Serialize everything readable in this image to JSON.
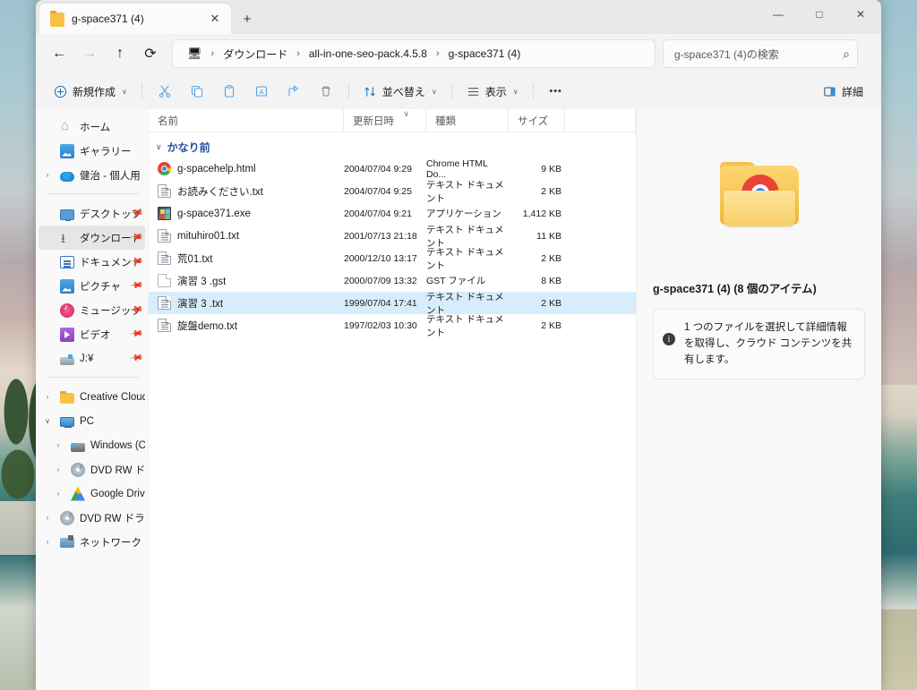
{
  "window": {
    "tab_title": "g-space371 (4)",
    "tab_close": "✕",
    "new_tab": "+",
    "minimize": "—",
    "maximize": "□",
    "close": "✕"
  },
  "nav": {
    "back": "←",
    "forward": "→",
    "up": "↑",
    "refresh": "⟳",
    "breadcrumb": [
      {
        "label": "🖥",
        "name": "this-pc"
      },
      {
        "label": "ダウンロード",
        "name": "downloads"
      },
      {
        "label": "all-in-one-seo-pack.4.5.8",
        "name": "all-in-one-seo-pack"
      },
      {
        "label": "g-space371 (4)",
        "name": "g-space371-4"
      }
    ],
    "separator": "›",
    "search_placeholder": "g-space371 (4)の検索",
    "search_icon": "⌕"
  },
  "toolbar": {
    "new_label": "新規作成",
    "cut_label": "切り取り",
    "copy_label": "コピー",
    "paste_label": "貼り付け",
    "rename_label": "名前の変更",
    "share_label": "共有",
    "delete_label": "削除",
    "sort_label": "並べ替え",
    "view_label": "表示",
    "more_label": "•••",
    "details_label": "詳細",
    "chevron": "∨"
  },
  "sidebar": {
    "items": [
      {
        "label": "ホーム",
        "icon": "home-icon",
        "chevron": "",
        "pinned": false,
        "selected": false,
        "indent": 0
      },
      {
        "label": "ギャラリー",
        "icon": "gallery-icon",
        "chevron": "",
        "pinned": false,
        "selected": false,
        "indent": 0
      },
      {
        "label": "健治 - 個人用",
        "icon": "onedrive-cloud-icon",
        "chevron": "›",
        "pinned": false,
        "selected": false,
        "indent": 0
      },
      {
        "separator": true
      },
      {
        "label": "デスクトップ",
        "icon": "desktop-icon",
        "chevron": "",
        "pinned": true,
        "selected": false,
        "indent": 0
      },
      {
        "label": "ダウンロード",
        "icon": "downloads-icon",
        "chevron": "",
        "pinned": true,
        "selected": true,
        "indent": 0
      },
      {
        "label": "ドキュメント",
        "icon": "documents-icon",
        "chevron": "",
        "pinned": true,
        "selected": false,
        "indent": 0
      },
      {
        "label": "ピクチャ",
        "icon": "pictures-icon",
        "chevron": "",
        "pinned": true,
        "selected": false,
        "indent": 0
      },
      {
        "label": "ミュージック",
        "icon": "music-icon",
        "chevron": "",
        "pinned": true,
        "selected": false,
        "indent": 0
      },
      {
        "label": "ビデオ",
        "icon": "video-icon",
        "chevron": "",
        "pinned": true,
        "selected": false,
        "indent": 0
      },
      {
        "label": "J:¥",
        "icon": "drive-icon",
        "chevron": "",
        "pinned": true,
        "selected": false,
        "indent": 0
      },
      {
        "separator": true
      },
      {
        "label": "Creative Cloud Files",
        "icon": "folder-icon",
        "chevron": "›",
        "pinned": false,
        "selected": false,
        "indent": 0
      },
      {
        "label": "PC",
        "icon": "pc-icon",
        "chevron": "∨",
        "pinned": false,
        "selected": false,
        "indent": 0
      },
      {
        "label": "Windows (C:)",
        "icon": "windows-disk-icon",
        "chevron": "›",
        "pinned": false,
        "selected": false,
        "indent": 1
      },
      {
        "label": "DVD RW ドライブ (C",
        "icon": "dvd-icon",
        "chevron": "›",
        "pinned": false,
        "selected": false,
        "indent": 1
      },
      {
        "label": "Google Drive (I:)",
        "icon": "google-drive-icon",
        "chevron": "›",
        "pinned": false,
        "selected": false,
        "indent": 1
      },
      {
        "label": "DVD RW ドライブ (G:",
        "icon": "dvd-icon",
        "chevron": "›",
        "pinned": false,
        "selected": false,
        "indent": 0
      },
      {
        "label": "ネットワーク",
        "icon": "network-icon",
        "chevron": "›",
        "pinned": false,
        "selected": false,
        "indent": 0
      }
    ]
  },
  "filelist": {
    "columns": {
      "name": "名前",
      "date": "更新日時",
      "type": "種類",
      "size": "サイズ"
    },
    "sort_indicator": "∨",
    "group": {
      "chevron": "∨",
      "label": "かなり前"
    },
    "rows": [
      {
        "name": "g-spacehelp.html",
        "date": "2004/07/04 9:29",
        "type": "Chrome HTML Do...",
        "size": "9 KB",
        "icon": "chrome-html-icon",
        "selected": false
      },
      {
        "name": "お読みください.txt",
        "date": "2004/07/04 9:25",
        "type": "テキスト ドキュメント",
        "size": "2 KB",
        "icon": "text-file-icon",
        "selected": false
      },
      {
        "name": "g-space371.exe",
        "date": "2004/07/04 9:21",
        "type": "アプリケーション",
        "size": "1,412 KB",
        "icon": "application-icon",
        "selected": false
      },
      {
        "name": "mituhiro01.txt",
        "date": "2001/07/13 21:18",
        "type": "テキスト ドキュメント",
        "size": "11 KB",
        "icon": "text-file-icon",
        "selected": false
      },
      {
        "name": "荒01.txt",
        "date": "2000/12/10 13:17",
        "type": "テキスト ドキュメント",
        "size": "2 KB",
        "icon": "text-file-icon",
        "selected": false
      },
      {
        "name": "演習 3 .gst",
        "date": "2000/07/09 13:32",
        "type": "GST ファイル",
        "size": "8 KB",
        "icon": "blank-file-icon",
        "selected": false
      },
      {
        "name": "演習 3 .txt",
        "date": "1999/07/04 17:41",
        "type": "テキスト ドキュメント",
        "size": "2 KB",
        "icon": "text-file-icon",
        "selected": true
      },
      {
        "name": "旋盤demo.txt",
        "date": "1997/02/03 10:30",
        "type": "テキスト ドキュメント",
        "size": "2 KB",
        "icon": "text-file-icon",
        "selected": false
      }
    ]
  },
  "details": {
    "title": "g-space371 (4) (8 個のアイテム)",
    "info_icon": "i",
    "info_text": "1 つのファイルを選択して詳細情報を取得し、クラウド コンテンツを共有します。"
  },
  "colors": {
    "selection": "#d8edfb",
    "group_header": "#2a4fa0",
    "window_bg": "#f3f3f3",
    "sidebar_bg": "#f9f9f9",
    "sidebar_selected": "#e6e6e6"
  }
}
